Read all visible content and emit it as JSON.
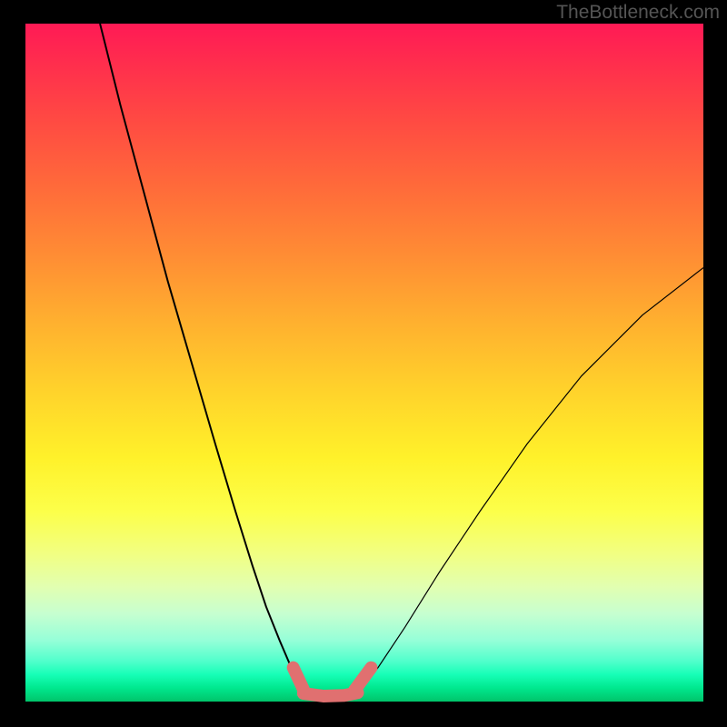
{
  "watermark": "TheBottleneck.com",
  "chart_data": {
    "type": "line",
    "title": "",
    "xlabel": "",
    "ylabel": "",
    "xlim": [
      0,
      100
    ],
    "ylim": [
      0,
      100
    ],
    "grid": false,
    "legend": false,
    "background_gradient": {
      "top_color": "#ff1a55",
      "mid_color": "#ffff30",
      "bottom_color": "#00c46a",
      "meaning": "high-mismatch (red) at top to optimal (green) at bottom"
    },
    "series": [
      {
        "name": "left-branch-curve",
        "color": "#000000",
        "stroke_width": 2,
        "x": [
          11.0,
          14.0,
          17.5,
          21.0,
          24.5,
          28.0,
          31.0,
          33.5,
          35.5,
          37.5,
          39.0,
          40.2,
          41.0
        ],
        "y": [
          100.0,
          88.0,
          75.0,
          62.0,
          50.0,
          38.0,
          28.0,
          20.0,
          14.0,
          9.0,
          5.5,
          3.0,
          1.5
        ]
      },
      {
        "name": "right-branch-curve",
        "color": "#000000",
        "stroke_width": 1.2,
        "x": [
          49.0,
          52.0,
          56.0,
          61.0,
          67.0,
          74.0,
          82.0,
          91.0,
          100.0
        ],
        "y": [
          1.5,
          5.0,
          11.0,
          19.0,
          28.0,
          38.0,
          48.0,
          57.0,
          64.0
        ]
      },
      {
        "name": "highlight-nub-left",
        "color": "#e07070",
        "stroke_width": 14,
        "linecap": "round",
        "x": [
          39.5,
          41.0
        ],
        "y": [
          5.0,
          1.8
        ]
      },
      {
        "name": "highlight-trough",
        "color": "#e07070",
        "stroke_width": 14,
        "linecap": "round",
        "x": [
          41.0,
          44.0,
          47.0,
          49.0
        ],
        "y": [
          1.2,
          0.8,
          0.9,
          1.3
        ]
      },
      {
        "name": "highlight-nub-right",
        "color": "#e07070",
        "stroke_width": 14,
        "linecap": "round",
        "x": [
          48.5,
          51.0
        ],
        "y": [
          1.6,
          5.0
        ]
      }
    ],
    "annotations": []
  }
}
